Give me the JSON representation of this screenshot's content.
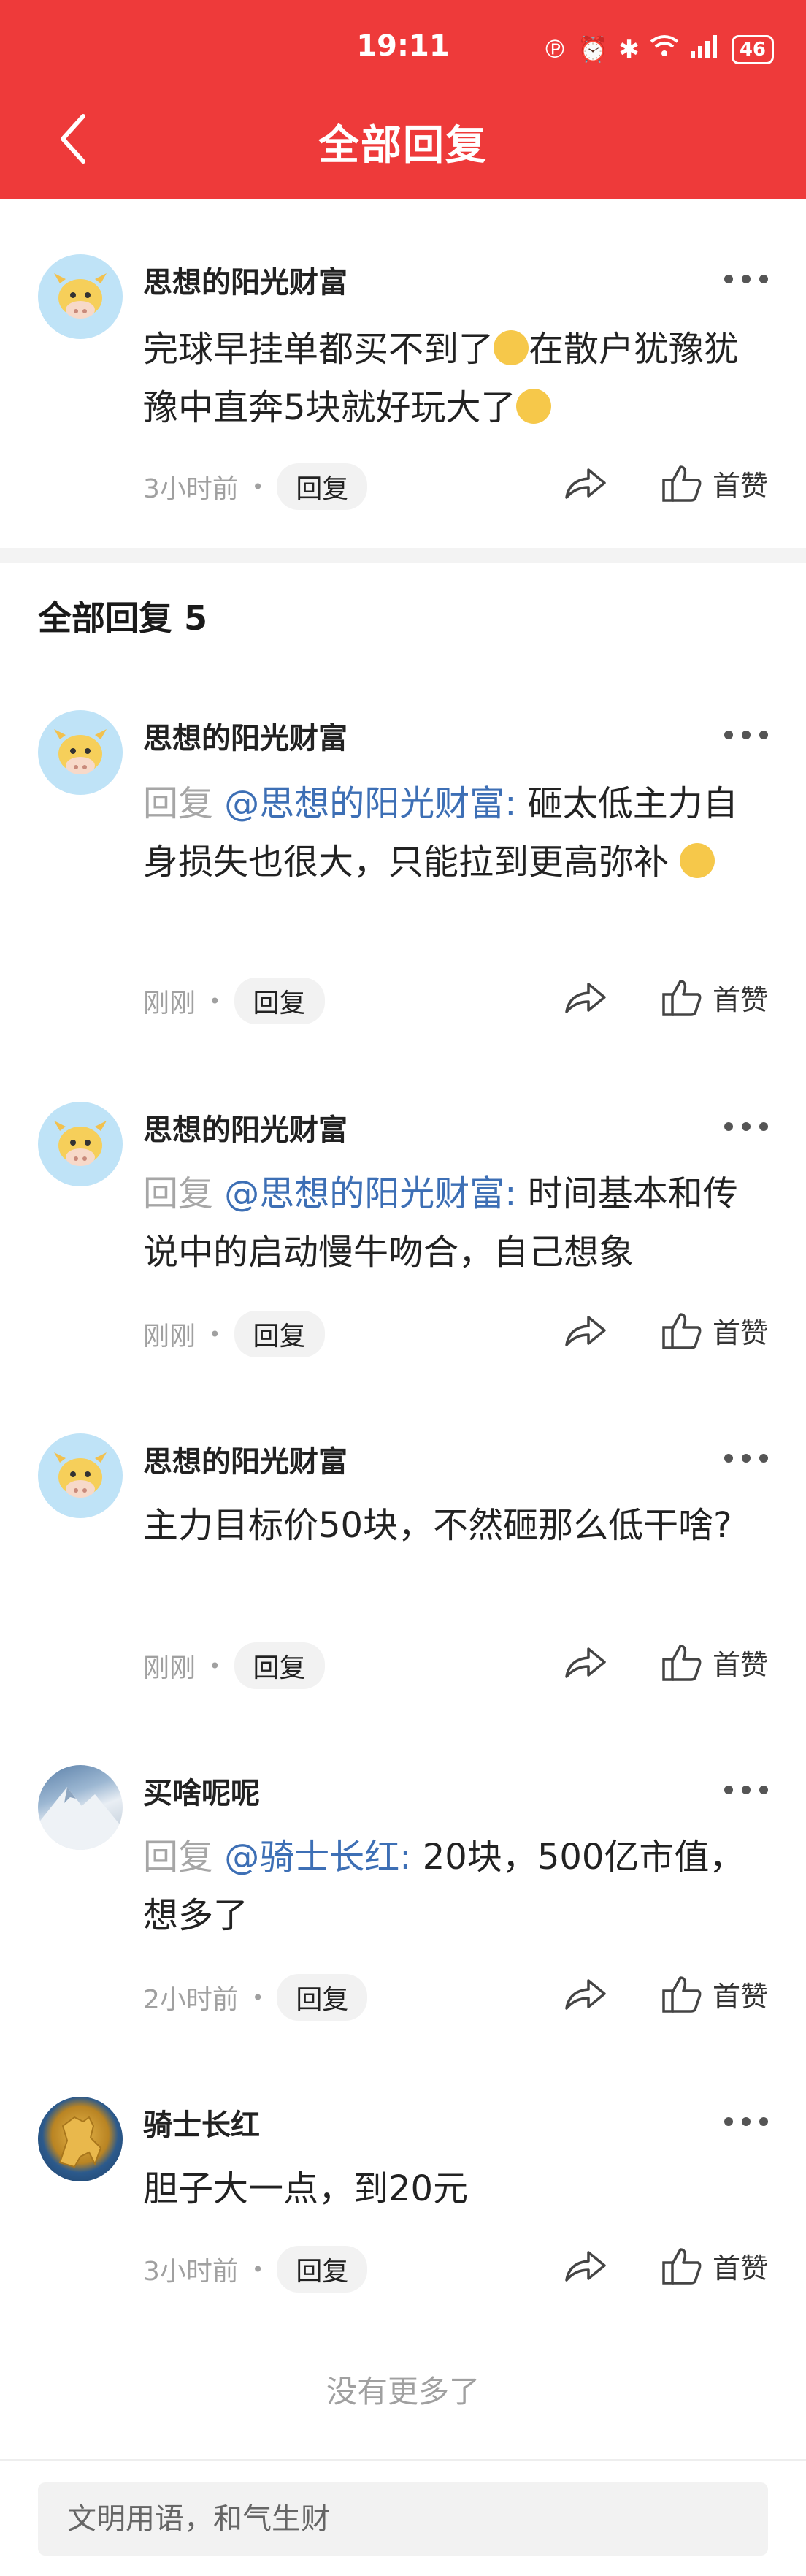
{
  "status_bar": {
    "time": "19:11",
    "icons": [
      "nfc-icon",
      "alarm-icon",
      "bluetooth-icon",
      "wifi-icon",
      "5g-signal-icon"
    ],
    "battery": "46"
  },
  "header": {
    "title": "全部回复"
  },
  "main_post": {
    "author": "思想的阳光财富",
    "text_a": "完球早挂单都买不到了",
    "text_b": "在散户犹豫犹豫中直奔5块就好玩大了",
    "time": "3小时前",
    "reply_label": "回复",
    "like_label": "首赞"
  },
  "replies_section": {
    "title": "全部回复 5"
  },
  "replies": [
    {
      "author": "思想的阳光财富",
      "prefix": "回复",
      "mention": "@思想的阳光财富:",
      "text": "砸太低主力自身损失也很大，只能拉到更高弥补",
      "time": "刚刚",
      "reply_label": "回复",
      "like_label": "首赞"
    },
    {
      "author": "思想的阳光财富",
      "prefix": "回复",
      "mention": "@思想的阳光财富:",
      "text": "时间基本和传说中的启动慢牛吻合，自己想象",
      "time": "刚刚",
      "reply_label": "回复",
      "like_label": "首赞"
    },
    {
      "author": "思想的阳光财富",
      "text": "主力目标价50块，不然砸那么低干啥?",
      "time": "刚刚",
      "reply_label": "回复",
      "like_label": "首赞"
    },
    {
      "author": "买啥呢呢",
      "prefix": "回复",
      "mention": "@骑士长红:",
      "text": "20块，500亿市值，想多了",
      "time": "2小时前",
      "reply_label": "回复",
      "like_label": "首赞"
    },
    {
      "author": "骑士长红",
      "text": "胆子大一点，到20元",
      "time": "3小时前",
      "reply_label": "回复",
      "like_label": "首赞"
    }
  ],
  "footer": {
    "no_more": "没有更多了",
    "input_placeholder": "文明用语，和气生财"
  },
  "colors": {
    "header_bg": "#ee3a3a",
    "mention": "#3d6fb5",
    "muted": "#a0a0a0"
  }
}
